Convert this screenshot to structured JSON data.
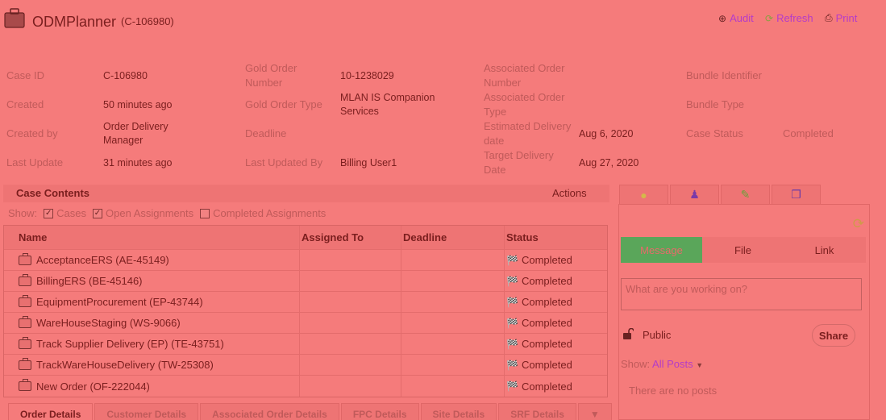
{
  "header": {
    "title": "ODMPlanner",
    "case_ref": "(C-106980)",
    "actions": [
      {
        "label": "Audit",
        "icon": "audit-icon"
      },
      {
        "label": "Refresh",
        "icon": "refresh-icon"
      },
      {
        "label": "Print",
        "icon": "print-icon"
      }
    ]
  },
  "fields": {
    "case_id": {
      "label": "Case ID",
      "value": "C-106980"
    },
    "created": {
      "label": "Created",
      "value": "50 minutes ago"
    },
    "created_by": {
      "label": "Created by",
      "value_line1": "Order Delivery",
      "value_line2": "Manager"
    },
    "last_update": {
      "label": "Last Update",
      "value": "31 minutes ago"
    },
    "gold_order_number": {
      "label_line1": "Gold Order",
      "label_line2": "Number",
      "value": "10-1238029"
    },
    "gold_order_type": {
      "label": "Gold Order Type",
      "value_line1": "MLAN IS Companion",
      "value_line2": "Services"
    },
    "deadline": {
      "label": "Deadline",
      "value": ""
    },
    "last_updated_by": {
      "label": "Last Updated By",
      "value": "Billing User1"
    },
    "assoc_order_number": {
      "label_line1": "Associated Order",
      "label_line2": "Number",
      "value": ""
    },
    "assoc_order_type": {
      "label_line1": "Associated Order",
      "label_line2": "Type",
      "value": ""
    },
    "est_delivery": {
      "label_line1": "Estimated Delivery",
      "label_line2": "date",
      "value": "Aug 6, 2020"
    },
    "target_delivery": {
      "label_line1": "Target Delivery",
      "label_line2": "Date",
      "value": "Aug 27, 2020"
    },
    "bundle_identifier": {
      "label": "Bundle Identifier",
      "value": ""
    },
    "bundle_type": {
      "label": "Bundle Type",
      "value": ""
    },
    "case_status": {
      "label": "Case Status",
      "value": "Completed"
    }
  },
  "case_contents": {
    "title": "Case Contents",
    "actions_label": "Actions",
    "show_label": "Show:",
    "filters": [
      {
        "label": "Cases",
        "checked": true
      },
      {
        "label": "Open Assignments",
        "checked": true
      },
      {
        "label": "Completed Assignments",
        "checked": false
      }
    ],
    "columns": [
      "Name",
      "Assigned To",
      "Deadline",
      "Status"
    ],
    "rows": [
      {
        "name": "AcceptanceERS (AE-45149)",
        "assigned_to": "",
        "deadline": "",
        "status": "Completed"
      },
      {
        "name": "BillingERS (BE-45146)",
        "assigned_to": "",
        "deadline": "",
        "status": "Completed"
      },
      {
        "name": "EquipmentProcurement (EP-43744)",
        "assigned_to": "",
        "deadline": "",
        "status": "Completed"
      },
      {
        "name": "WareHouseStaging (WS-9066)",
        "assigned_to": "",
        "deadline": "",
        "status": "Completed"
      },
      {
        "name": "Track Supplier Delivery (EP) (TE-43751)",
        "assigned_to": "",
        "deadline": "",
        "status": "Completed"
      },
      {
        "name": "TrackWareHouseDelivery (TW-25308)",
        "assigned_to": "",
        "deadline": "",
        "status": "Completed"
      },
      {
        "name": "New Order (OF-222044)",
        "assigned_to": "",
        "deadline": "",
        "status": "Completed"
      }
    ]
  },
  "bottom_tabs": [
    {
      "label": "Order Details",
      "active": true
    },
    {
      "label": "Customer Details",
      "active": false
    },
    {
      "label": "Associated Order Details",
      "active": false
    },
    {
      "label": "FPC Details",
      "active": false
    },
    {
      "label": "Site Details",
      "active": false
    },
    {
      "label": "SRF Details",
      "active": false
    },
    {
      "label": "▼",
      "active": false
    }
  ],
  "pulse": {
    "side_tabs": [
      "chat-bubble-icon",
      "people-icon",
      "pencil-icon",
      "windows-icon"
    ],
    "post_types": [
      "Message",
      "File",
      "Link"
    ],
    "active_post_type": "Message",
    "placeholder": "What are you working on?",
    "visibility": "Public",
    "share_label": "Share",
    "show_label": "Show:",
    "posts_filter": "All Posts",
    "empty_text": "There are no posts"
  },
  "colors": {
    "background": "#f57b7b",
    "link": "#b53cc8",
    "active_post_tab": "#5aa65a"
  }
}
